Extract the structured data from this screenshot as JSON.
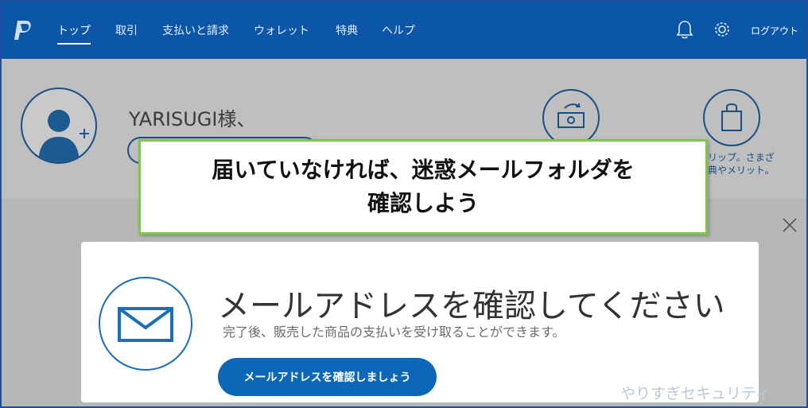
{
  "nav": {
    "items": [
      "トップ",
      "取引",
      "支払いと請求",
      "ウォレット",
      "特典",
      "ヘルプ"
    ],
    "logout": "ログアウト"
  },
  "profile": {
    "greeting": "YARISUGI様、"
  },
  "promo": {
    "line1": "クリップ。さまざ",
    "line2": "特典やメリット。"
  },
  "callout": {
    "line1": "届いていなければ、迷惑メールフォルダを",
    "line2": "確認しよう"
  },
  "modal": {
    "title": "メールアドレスを確認してください",
    "subtitle": "完了後、販売した商品の支払いを受け取ることができます。",
    "cta": "メールアドレスを確認しましょう"
  },
  "watermark": "やりすぎセキュリティ",
  "colors": {
    "nav_bg": "#0b56a6",
    "callout_border": "#7cc64a",
    "cta_bg": "#0d67b8"
  },
  "icons": [
    "paypal-logo-icon",
    "bell-icon",
    "gear-icon",
    "avatar-icon",
    "money-transfer-icon",
    "shopping-bag-icon",
    "close-icon",
    "mail-icon"
  ]
}
